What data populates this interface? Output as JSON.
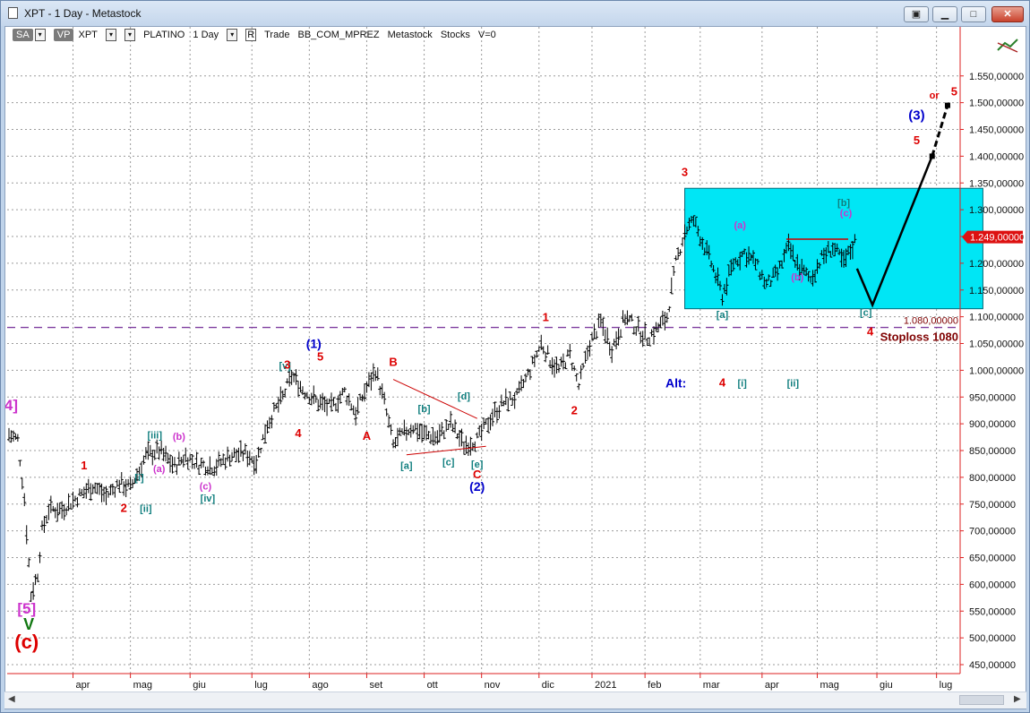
{
  "window": {
    "title": "XPT - 1 Day - Metastock",
    "buttons": [
      "restore-down",
      "minimize",
      "maximize",
      "close"
    ]
  },
  "toolbar": {
    "sa": "SA",
    "vp": "VP",
    "symbol": "XPT",
    "name": "PLATINO",
    "period": "1 Day",
    "r_label": "R",
    "trade": "Trade",
    "account": "BB_COM_MPREZ",
    "source": "Metastock",
    "kind": "Stocks",
    "volume": "V=0"
  },
  "colors": {
    "red": "#dd0000",
    "blue": "#0000cc",
    "teal": "#117f7f",
    "magenta": "#cc33cc",
    "darkred": "#7f0000",
    "green": "#117711",
    "box": "#00e6f5",
    "axis": "#dd2222",
    "price_flag": "#dd1111",
    "stoploss_line": "#7f3fa0",
    "bars": "#000000"
  },
  "chart_data": {
    "type": "ohlc",
    "title": "",
    "x_tick_labels": [
      "apr",
      "mag",
      "giu",
      "lug",
      "ago",
      "set",
      "ott",
      "nov",
      "dic",
      "2021",
      "feb",
      "mar",
      "apr",
      "mag",
      "giu",
      "lug"
    ],
    "y_range": [
      425,
      1600
    ],
    "y_tick_values": [
      450,
      500,
      550,
      600,
      650,
      700,
      750,
      800,
      850,
      900,
      950,
      1000,
      1050,
      1100,
      1150,
      1200,
      1250,
      1300,
      1350,
      1400,
      1450,
      1500,
      1550
    ],
    "y_tick_labels": [
      "450,00000",
      "500,00000",
      "550,00000",
      "600,00000",
      "650,00000",
      "700,00000",
      "750,00000",
      "800,00000",
      "850,00000",
      "900,00000",
      "950,00000",
      "1.000,00000",
      "1.050,00000",
      "1.100,00000",
      "1.150,00000",
      "1.200,00000",
      "1.250,00000",
      "1.300,00000",
      "1.350,00000",
      "1.400,00000",
      "1.450,00000",
      "1.500,00000",
      "1.550,00000"
    ],
    "last_price": 1249,
    "last_price_label": "1.249,00000",
    "stoploss": 1080,
    "stoploss_label": "1.080,00000",
    "stoploss_text": "Stoploss 1080",
    "price_anchors": [
      {
        "i": 0,
        "p": 880
      },
      {
        "i": 4,
        "p": 870
      },
      {
        "i": 7,
        "p": 760
      },
      {
        "i": 10,
        "p": 580
      },
      {
        "i": 13,
        "p": 620
      },
      {
        "i": 15,
        "p": 700
      },
      {
        "i": 18,
        "p": 740
      },
      {
        "i": 24,
        "p": 740
      },
      {
        "i": 30,
        "p": 760
      },
      {
        "i": 38,
        "p": 785
      },
      {
        "i": 44,
        "p": 765
      },
      {
        "i": 50,
        "p": 790
      },
      {
        "i": 55,
        "p": 780
      },
      {
        "i": 62,
        "p": 840
      },
      {
        "i": 68,
        "p": 850
      },
      {
        "i": 75,
        "p": 820
      },
      {
        "i": 80,
        "p": 840
      },
      {
        "i": 85,
        "p": 825
      },
      {
        "i": 93,
        "p": 820
      },
      {
        "i": 100,
        "p": 840
      },
      {
        "i": 107,
        "p": 845
      },
      {
        "i": 112,
        "p": 830
      },
      {
        "i": 117,
        "p": 900
      },
      {
        "i": 124,
        "p": 950
      },
      {
        "i": 128,
        "p": 990
      },
      {
        "i": 134,
        "p": 960
      },
      {
        "i": 140,
        "p": 940
      },
      {
        "i": 146,
        "p": 930
      },
      {
        "i": 152,
        "p": 960
      },
      {
        "i": 157,
        "p": 920
      },
      {
        "i": 161,
        "p": 960
      },
      {
        "i": 166,
        "p": 1000
      },
      {
        "i": 170,
        "p": 940
      },
      {
        "i": 174,
        "p": 860
      },
      {
        "i": 178,
        "p": 880
      },
      {
        "i": 183,
        "p": 895
      },
      {
        "i": 188,
        "p": 880
      },
      {
        "i": 194,
        "p": 875
      },
      {
        "i": 200,
        "p": 900
      },
      {
        "i": 206,
        "p": 860
      },
      {
        "i": 212,
        "p": 870
      },
      {
        "i": 218,
        "p": 910
      },
      {
        "i": 224,
        "p": 940
      },
      {
        "i": 230,
        "p": 950
      },
      {
        "i": 236,
        "p": 1000
      },
      {
        "i": 241,
        "p": 1050
      },
      {
        "i": 245,
        "p": 1020
      },
      {
        "i": 249,
        "p": 1000
      },
      {
        "i": 254,
        "p": 1030
      },
      {
        "i": 258,
        "p": 970
      },
      {
        "i": 263,
        "p": 1050
      },
      {
        "i": 268,
        "p": 1090
      },
      {
        "i": 273,
        "p": 1040
      },
      {
        "i": 279,
        "p": 1100
      },
      {
        "i": 284,
        "p": 1080
      },
      {
        "i": 289,
        "p": 1060
      },
      {
        "i": 294,
        "p": 1080
      },
      {
        "i": 298,
        "p": 1100
      },
      {
        "i": 302,
        "p": 1200
      },
      {
        "i": 306,
        "p": 1260
      },
      {
        "i": 310,
        "p": 1280
      },
      {
        "i": 314,
        "p": 1240
      },
      {
        "i": 318,
        "p": 1200
      },
      {
        "i": 323,
        "p": 1140
      },
      {
        "i": 328,
        "p": 1200
      },
      {
        "i": 333,
        "p": 1220
      },
      {
        "i": 338,
        "p": 1200
      },
      {
        "i": 343,
        "p": 1160
      },
      {
        "i": 348,
        "p": 1180
      },
      {
        "i": 353,
        "p": 1230
      },
      {
        "i": 358,
        "p": 1190
      },
      {
        "i": 363,
        "p": 1170
      },
      {
        "i": 368,
        "p": 1210
      },
      {
        "i": 373,
        "p": 1230
      },
      {
        "i": 378,
        "p": 1200
      },
      {
        "i": 383,
        "p": 1240
      }
    ],
    "projection": [
      {
        "date_index": 384,
        "price": 1190
      },
      {
        "date_index": 391,
        "price": 1122
      },
      {
        "date_index": 418,
        "price": 1400
      },
      {
        "date_index": 425,
        "price": 1495
      }
    ],
    "resistance_line": {
      "from_index": 352,
      "to_index": 380,
      "price": 1245
    },
    "triangle": {
      "upper": [
        {
          "i": 174,
          "p": 983
        },
        {
          "i": 212,
          "p": 910
        }
      ],
      "lower": [
        {
          "i": 180,
          "p": 842
        },
        {
          "i": 216,
          "p": 858
        }
      ]
    },
    "box": {
      "from_index": 306,
      "to_index": 441,
      "low": 1115,
      "high": 1340
    },
    "labels": [
      {
        "text": "4]",
        "i": 1,
        "p": 925,
        "style": "magenta-big"
      },
      {
        "text": "[5]",
        "i": 8,
        "p": 545,
        "style": "magenta-big"
      },
      {
        "text": "V",
        "i": 9,
        "p": 515,
        "style": "green-big"
      },
      {
        "text": "(c)",
        "i": 8,
        "p": 480,
        "style": "red-big"
      },
      {
        "text": "1",
        "i": 34,
        "p": 815,
        "style": "red"
      },
      {
        "text": "2",
        "i": 52,
        "p": 735,
        "style": "red"
      },
      {
        "text": "[i]",
        "i": 59,
        "p": 793,
        "style": "teal"
      },
      {
        "text": "[ii]",
        "i": 62,
        "p": 735,
        "style": "teal"
      },
      {
        "text": "[iii]",
        "i": 66,
        "p": 873,
        "style": "teal"
      },
      {
        "text": "(a)",
        "i": 68,
        "p": 810,
        "style": "magenta"
      },
      {
        "text": "(b)",
        "i": 77,
        "p": 870,
        "style": "magenta"
      },
      {
        "text": "(c)",
        "i": 89,
        "p": 777,
        "style": "magenta"
      },
      {
        "text": "[iv]",
        "i": 90,
        "p": 755,
        "style": "teal"
      },
      {
        "text": "[v]",
        "i": 125,
        "p": 1002,
        "style": "teal"
      },
      {
        "text": "3",
        "i": 126,
        "p": 1003,
        "style": "red"
      },
      {
        "text": "4",
        "i": 131,
        "p": 875,
        "style": "red"
      },
      {
        "text": "5",
        "i": 141,
        "p": 1018,
        "style": "red"
      },
      {
        "text": "(1)",
        "i": 138,
        "p": 1042,
        "style": "blue"
      },
      {
        "text": "A",
        "i": 162,
        "p": 870,
        "style": "red"
      },
      {
        "text": "B",
        "i": 174,
        "p": 1008,
        "style": "red"
      },
      {
        "text": "[a]",
        "i": 180,
        "p": 816,
        "style": "teal"
      },
      {
        "text": "[b]",
        "i": 188,
        "p": 922,
        "style": "teal"
      },
      {
        "text": "[c]",
        "i": 199,
        "p": 822,
        "style": "teal"
      },
      {
        "text": "[d]",
        "i": 206,
        "p": 945,
        "style": "teal"
      },
      {
        "text": "[e]",
        "i": 212,
        "p": 818,
        "style": "teal"
      },
      {
        "text": "C",
        "i": 212,
        "p": 798,
        "style": "red"
      },
      {
        "text": "(2)",
        "i": 212,
        "p": 775,
        "style": "blue"
      },
      {
        "text": "1",
        "i": 243,
        "p": 1092,
        "style": "red"
      },
      {
        "text": "2",
        "i": 256,
        "p": 918,
        "style": "red"
      },
      {
        "text": "3",
        "i": 306,
        "p": 1363,
        "style": "red"
      },
      {
        "text": "[a]",
        "i": 323,
        "p": 1098,
        "style": "teal"
      },
      {
        "text": "(a)",
        "i": 331,
        "p": 1265,
        "style": "magenta"
      },
      {
        "text": "(b)",
        "i": 357,
        "p": 1168,
        "style": "magenta"
      },
      {
        "text": "[b]",
        "i": 378,
        "p": 1307,
        "style": "teal"
      },
      {
        "text": "(c)",
        "i": 379,
        "p": 1288,
        "style": "magenta"
      },
      {
        "text": "[c]",
        "i": 388,
        "p": 1102,
        "style": "teal"
      },
      {
        "text": "4",
        "i": 390,
        "p": 1065,
        "style": "red"
      },
      {
        "text": "Alt:",
        "i": 302,
        "p": 968,
        "style": "blue"
      },
      {
        "text": "4",
        "i": 323,
        "p": 970,
        "style": "red"
      },
      {
        "text": "[i]",
        "i": 332,
        "p": 970,
        "style": "teal"
      },
      {
        "text": "[ii]",
        "i": 355,
        "p": 970,
        "style": "teal"
      },
      {
        "text": "(3)",
        "i": 411,
        "p": 1468,
        "style": "blue-big"
      },
      {
        "text": "5",
        "i": 411,
        "p": 1422,
        "style": "red"
      },
      {
        "text": "or",
        "i": 419,
        "p": 1508,
        "style": "red-small"
      },
      {
        "text": "5",
        "i": 428,
        "p": 1514,
        "style": "red"
      }
    ]
  }
}
